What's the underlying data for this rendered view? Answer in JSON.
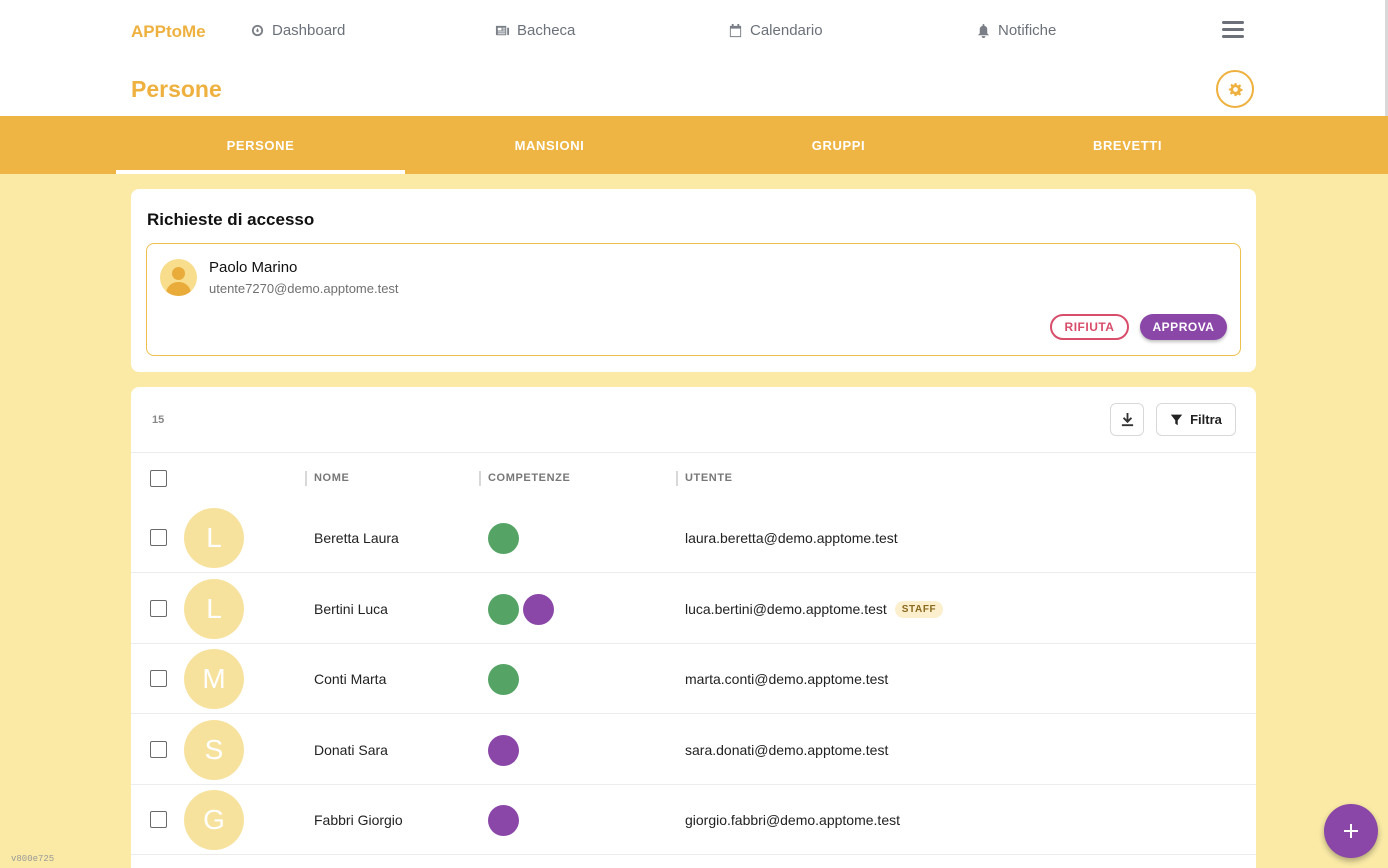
{
  "app": {
    "brand": "APPtoMe",
    "version": "v800e725"
  },
  "nav": {
    "items": [
      {
        "label": "Dashboard",
        "icon": "dashboard-icon"
      },
      {
        "label": "Bacheca",
        "icon": "newspaper-icon"
      },
      {
        "label": "Calendario",
        "icon": "calendar-icon"
      },
      {
        "label": "Notifiche",
        "icon": "bell-icon"
      }
    ],
    "menu_icon": "hamburger-menu-icon"
  },
  "header": {
    "title": "Persone",
    "settings_icon": "gear-icon"
  },
  "tabs": [
    {
      "label": "PERSONE",
      "active": true
    },
    {
      "label": "MANSIONI",
      "active": false
    },
    {
      "label": "GRUPPI",
      "active": false
    },
    {
      "label": "BREVETTI",
      "active": false
    }
  ],
  "access_requests": {
    "title": "Richieste di accesso",
    "items": [
      {
        "name": "Paolo Marino",
        "email": "utente7270@demo.apptome.test",
        "reject_label": "RIFIUTA",
        "approve_label": "APPROVA"
      }
    ]
  },
  "people_list": {
    "count": "15",
    "filter_label": "Filtra",
    "columns": {
      "name": "NOME",
      "skills": "COMPETENZE",
      "user": "UTENTE"
    },
    "rows": [
      {
        "initial": "L",
        "name": "Beretta Laura",
        "skills": [
          "#55a466"
        ],
        "email": "laura.beretta@demo.apptome.test",
        "badge": ""
      },
      {
        "initial": "L",
        "name": "Bertini Luca",
        "skills": [
          "#55a466",
          "#8a47a8"
        ],
        "email": "luca.bertini@demo.apptome.test",
        "badge": "STAFF"
      },
      {
        "initial": "M",
        "name": "Conti Marta",
        "skills": [
          "#55a466"
        ],
        "email": "marta.conti@demo.apptome.test",
        "badge": ""
      },
      {
        "initial": "S",
        "name": "Donati Sara",
        "skills": [
          "#8a47a8"
        ],
        "email": "sara.donati@demo.apptome.test",
        "badge": ""
      },
      {
        "initial": "G",
        "name": "Fabbri Giorgio",
        "skills": [
          "#8a47a8"
        ],
        "email": "giorgio.fabbri@demo.apptome.test",
        "badge": ""
      }
    ]
  },
  "colors": {
    "brand": "#eeb13f",
    "tabbar": "#eeb544",
    "page_bg": "#faeaa6",
    "reject": "#d84d6a",
    "approve": "#8a47a8",
    "skill_green": "#55a466",
    "skill_purple": "#8a47a8"
  }
}
